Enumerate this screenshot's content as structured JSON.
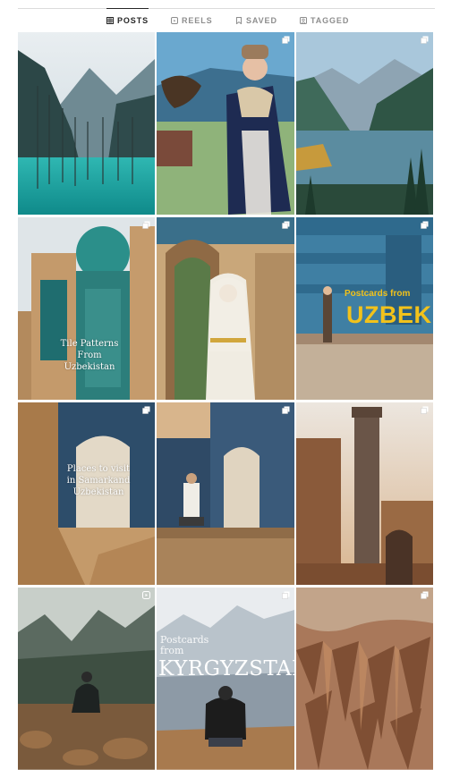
{
  "tabs": [
    {
      "label": "POSTS",
      "icon": "grid-icon",
      "active": true
    },
    {
      "label": "REELS",
      "icon": "reels-icon",
      "active": false
    },
    {
      "label": "SAVED",
      "icon": "bookmark-icon",
      "active": false
    },
    {
      "label": "TAGGED",
      "icon": "tag-icon",
      "active": false
    }
  ],
  "posts": [
    {
      "subject": "turquoise lake with forest",
      "badge": "none"
    },
    {
      "subject": "woman with eagle in traditional coat",
      "badge": "carousel-icon"
    },
    {
      "subject": "mountain lake with pines",
      "badge": "carousel-icon"
    },
    {
      "subject": "blue tiled mausoleums",
      "badge": "carousel-icon",
      "overlay": "Tile Patterns\nFrom\nUzbekistan"
    },
    {
      "subject": "woman in floral dress in archway",
      "badge": "carousel-icon"
    },
    {
      "subject": "man by mosaic wall",
      "badge": "carousel-icon",
      "overlay_small": "Postcards from",
      "overlay_big": "UZBEKIS"
    },
    {
      "subject": "brick corridor with blue portal",
      "badge": "carousel-icon",
      "overlay": "Places to visit\nin Samarkand\nUzbekistan"
    },
    {
      "subject": "man sitting on steps by mausoleum",
      "badge": "carousel-icon"
    },
    {
      "subject": "minaret at sunset",
      "badge": "carousel-icon"
    },
    {
      "subject": "man crouching in mountains",
      "badge": "reels-icon"
    },
    {
      "subject": "man on cliff, snowy peaks",
      "badge": "carousel-icon",
      "overlay_small": "Postcards\nfrom",
      "overlay_big": "KYRGYZSTAN"
    },
    {
      "subject": "eroded red canyon",
      "badge": "carousel-icon"
    }
  ]
}
